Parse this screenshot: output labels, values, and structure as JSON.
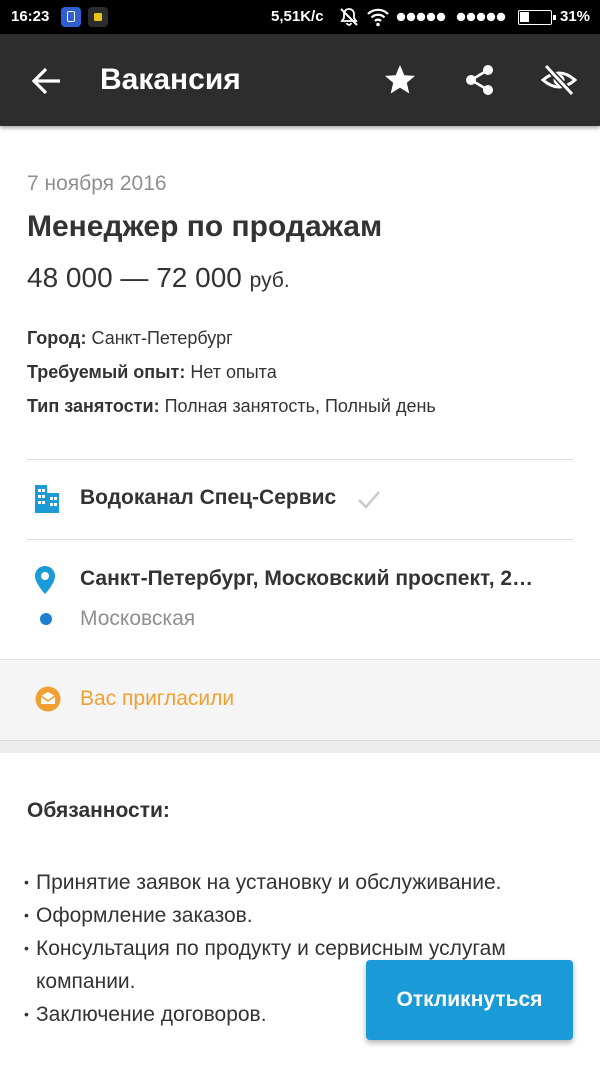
{
  "status_bar": {
    "time": "16:23",
    "network_speed": "5,51K/c",
    "battery_percent": "31%",
    "icons": [
      "app-notification-icon",
      "app-notification-icon",
      "mute-icon",
      "wifi-icon",
      "signal-icon",
      "signal-icon",
      "battery-icon"
    ]
  },
  "toolbar": {
    "title": "Вакансия",
    "icons": [
      "back-arrow-icon",
      "star-icon",
      "share-icon",
      "hide-eye-icon"
    ]
  },
  "vacancy": {
    "date": "7 ноября 2016",
    "title": "Менеджер по продажам",
    "salary_range": "48 000 — 72 000",
    "salary_currency": "руб.",
    "city_label": "Город:",
    "city_value": "Санкт-Петербург",
    "experience_label": "Требуемый опыт:",
    "experience_value": "Нет опыта",
    "employment_label": "Тип занятости:",
    "employment_value": "Полная занятость, Полный день"
  },
  "company": {
    "name": "Водоканал Спец-Сервис"
  },
  "location": {
    "address": "Санкт-Петербург, Московский проспект, 2…",
    "metro": "Московская",
    "metro_color": "#1e7fd2"
  },
  "invitation": {
    "text": "Вас пригласили",
    "color": "#f0a030"
  },
  "duties": {
    "heading": "Обязанности:",
    "items": [
      "Принятие заявок на установку и обслуживание.",
      "Оформление заказов.",
      "Консультация по продукту и сервисным услугам компании.",
      "Заключение договоров."
    ]
  },
  "apply_button": {
    "label": "Откликнуться",
    "color": "#1a9bd7"
  }
}
